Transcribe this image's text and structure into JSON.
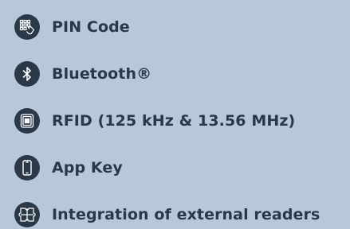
{
  "features": [
    {
      "label": "PIN Code",
      "icon": "keypad-hand-icon"
    },
    {
      "label": "Bluetooth®",
      "icon": "bluetooth-icon"
    },
    {
      "label": "RFID (125 kHz & 13.56 MHz)",
      "icon": "rfid-chip-card-icon"
    },
    {
      "label": "App Key",
      "icon": "smartphone-icon"
    },
    {
      "label": "Integration of external readers",
      "icon": "puzzle-icon"
    }
  ],
  "colors": {
    "background": "#b7c8db",
    "text": "#2a3848",
    "icon_circle": "#2a3848"
  }
}
